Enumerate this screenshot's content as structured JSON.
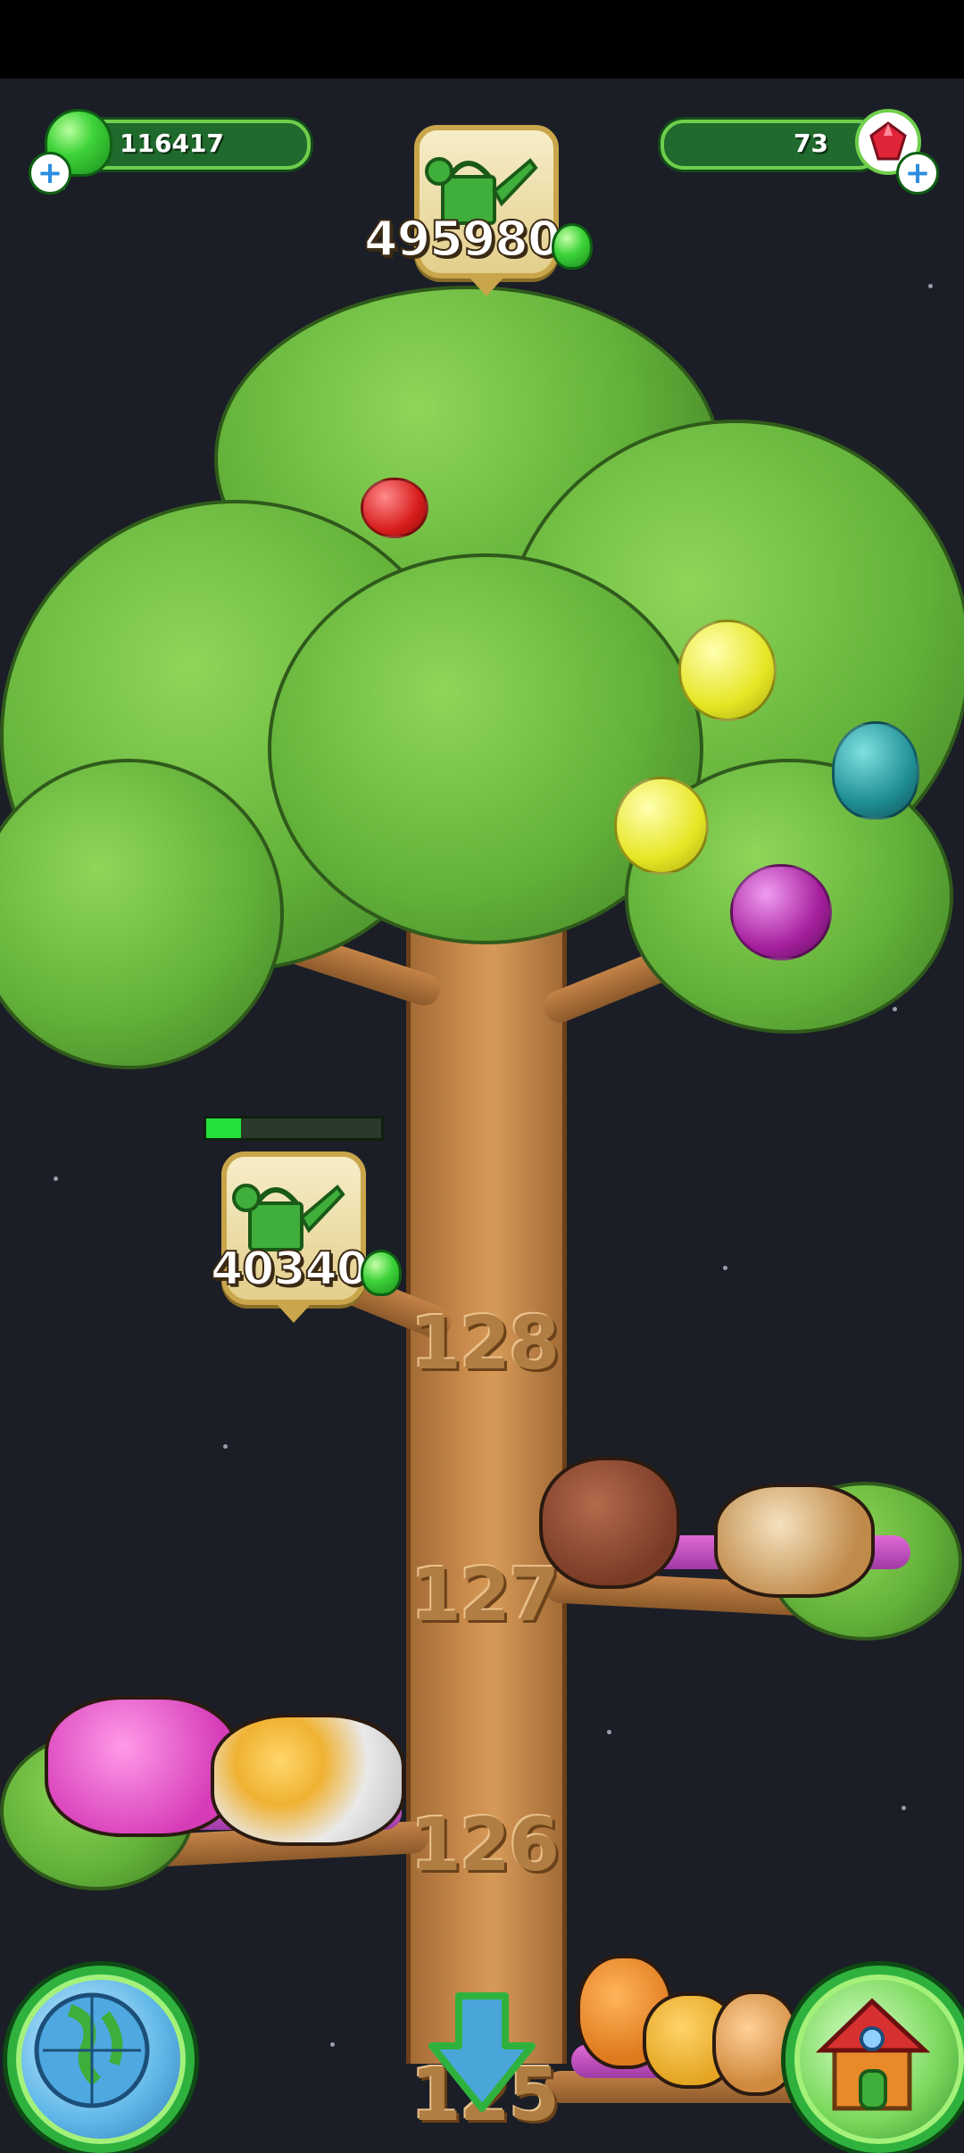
{
  "hud": {
    "green_gems": "116417",
    "red_gems": "73",
    "add_icon": "plus-icon",
    "top_offer": {
      "price": "495980",
      "icon": "watering-can-icon",
      "currency_icon": "green-gem-icon"
    }
  },
  "tree": {
    "upgrade_offer": {
      "price": "40340",
      "icon": "watering-can-icon",
      "progress": 0.2
    },
    "levels": [
      "128",
      "127",
      "126",
      "125"
    ],
    "fruits": [
      "red-apple",
      "yellow-fruit",
      "yellow-fruit",
      "teal-fruit",
      "purple-fruit"
    ]
  },
  "animals": {
    "level_127": [
      "boar",
      "corgi"
    ],
    "level_126": [
      "pink-dragon",
      "pelican"
    ],
    "level_125": [
      "squirrel",
      "fox",
      "hamster"
    ]
  },
  "nav": {
    "world_button": "globe-icon",
    "scroll_down_button": "arrow-down-icon",
    "home_button": "house-icon"
  },
  "colors": {
    "gem_green": "#3fd43a",
    "trunk": "#c98a4b",
    "foliage": "#64b23a",
    "background": "#1b1e26"
  }
}
